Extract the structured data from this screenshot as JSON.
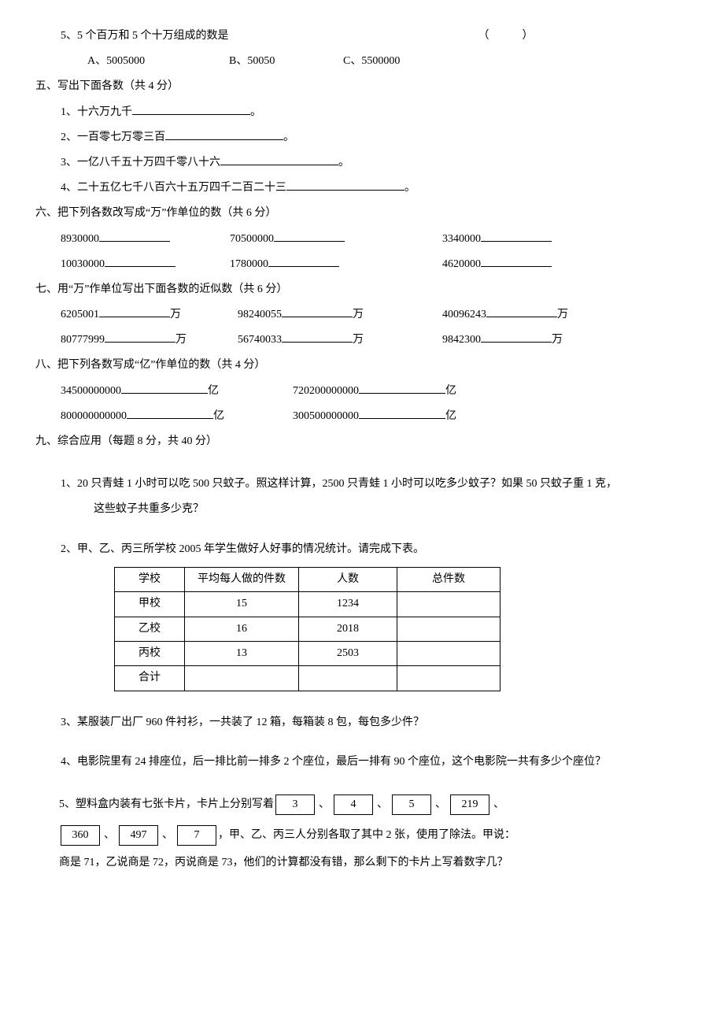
{
  "q4_5": {
    "num": "5、",
    "text": "5 个百万和 5 个十万组成的数是",
    "paren": "（　　　）",
    "opts": {
      "A": "A、5005000",
      "B": "B、50050",
      "C": "C、5500000"
    }
  },
  "sec5": {
    "title": "五、写出下面各数（共 4 分）",
    "items": [
      "1、十六万九千",
      "2、一百零七万零三百",
      "3、一亿八千五十万四千零八十六",
      "4、二十五亿七千八百六十五万四千二百二十三"
    ]
  },
  "sec6": {
    "title": "六、把下列各数改写成“万”作单位的数（共 6 分）",
    "r1": {
      "a": "8930000",
      "b": "70500000",
      "c": "3340000"
    },
    "r2": {
      "a": "10030000",
      "b": "1780000",
      "c": "4620000"
    }
  },
  "sec7": {
    "title": "七、用“万”作单位写出下面各数的近似数（共 6 分）",
    "unit": "万",
    "r1": {
      "a": "6205001",
      "b": "98240055",
      "c": "40096243"
    },
    "r2": {
      "a": "80777999",
      "b": "56740033",
      "c": "9842300"
    }
  },
  "sec8": {
    "title": "八、把下列各数写成“亿”作单位的数（共 4 分）",
    "unit": "亿",
    "r1": {
      "a": "34500000000",
      "b": "720200000000"
    },
    "r2": {
      "a": "800000000000",
      "b": "300500000000"
    }
  },
  "sec9": {
    "title": "九、综合应用（每题 8 分，共 40 分）",
    "q1": "1、20 只青蛙 1 小时可以吃 500 只蚊子。照这样计算，2500 只青蛙 1 小时可以吃多少蚊子？如果 50 只蚊子重 1 克，",
    "q1b": "这些蚊子共重多少克？",
    "q2": "2、甲、乙、丙三所学校 2005 年学生做好人好事的情况统计。请完成下表。",
    "table": {
      "headers": [
        "学校",
        "平均每人做的件数",
        "人数",
        "总件数"
      ],
      "rows": [
        [
          "甲校",
          "15",
          "1234",
          ""
        ],
        [
          "乙校",
          "16",
          "2018",
          ""
        ],
        [
          "丙校",
          "13",
          "2503",
          ""
        ],
        [
          "合计",
          "",
          "",
          ""
        ]
      ]
    },
    "q3": "3、某服装厂出厂 960 件衬衫，一共装了 12 箱，每箱装 8 包，每包多少件？",
    "q4": "4、电影院里有 24 排座位，后一排比前一排多 2 个座位，最后一排有 90 个座位，这个电影院一共有多少个座位？",
    "q5": {
      "lead": "5、塑料盒内装有七张卡片，卡片上分别写着",
      "cards1": [
        "3",
        "4",
        "5",
        "219"
      ],
      "cards2": [
        "360",
        "497",
        "7"
      ],
      "mid": "，甲、乙、丙三人分别各取了其中 2 张，使用了除法。甲说：",
      "tail": "商是 71，乙说商是 72，丙说商是 73，他们的计算都没有错，那么剩下的卡片上写着数字几？"
    },
    "sep_dot": "、"
  }
}
